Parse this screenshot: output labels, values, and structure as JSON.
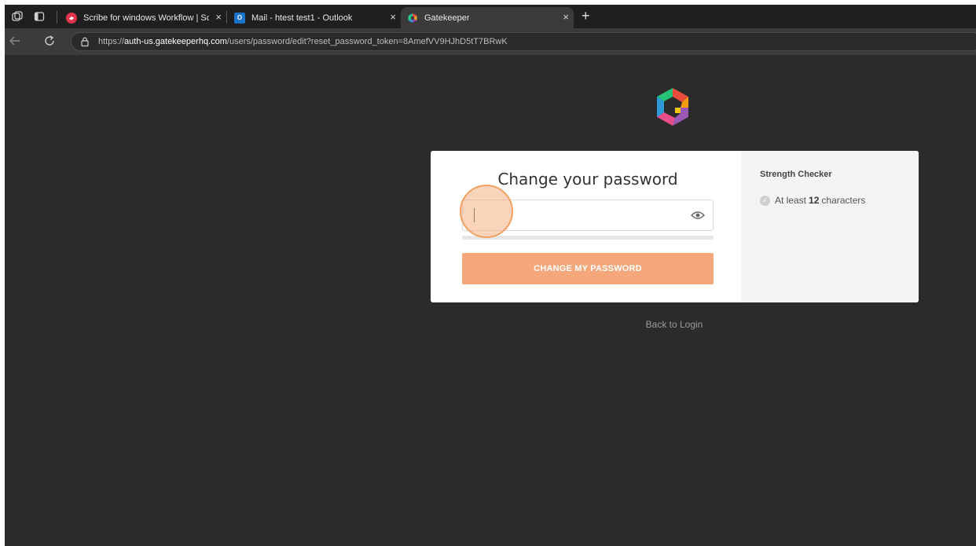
{
  "browser": {
    "tabs": [
      {
        "title": "Scribe for windows Workflow | Sc",
        "favicon_color": "#e0334c",
        "favicon": "scribe-icon"
      },
      {
        "title": "Mail - htest test1 - Outlook",
        "favicon_color": "#1a73c8",
        "favicon": "outlook-icon"
      },
      {
        "title": "Gatekeeper",
        "favicon": "gatekeeper-icon",
        "active": true
      }
    ],
    "close_glyph": "×",
    "new_tab_glyph": "+",
    "url": {
      "scheme": "https://",
      "host": "auth-us.gatekeeperhq.com",
      "path": "/users/password/edit?reset_password_token=8AmefVV9HJhD5tT7BRwK"
    }
  },
  "page": {
    "title": "Change your password",
    "password_value": "",
    "submit_label": "CHANGE MY PASSWORD",
    "submit_color": "#f4a77a",
    "back_link": "Back to Login"
  },
  "strength_checker": {
    "title": "Strength Checker",
    "rule_prefix": "At least",
    "rule_count": "12",
    "rule_suffix": "characters"
  }
}
